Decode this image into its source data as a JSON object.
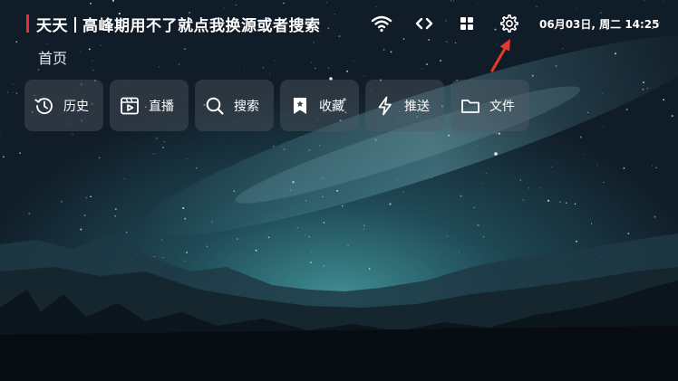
{
  "header": {
    "app_name": "天天",
    "notice": "高峰期用不了就点我换源或者搜索",
    "datetime": "06月03日, 周二 14:25",
    "icons": [
      "wifi-icon",
      "code-icon",
      "grid-icon",
      "gear-icon"
    ]
  },
  "page": {
    "label": "首页"
  },
  "menu": {
    "items": [
      {
        "label": "历史",
        "icon": "history-icon"
      },
      {
        "label": "直播",
        "icon": "live-icon"
      },
      {
        "label": "搜索",
        "icon": "search-icon"
      },
      {
        "label": "收藏",
        "icon": "bookmark-icon"
      },
      {
        "label": "推送",
        "icon": "bolt-icon"
      },
      {
        "label": "文件",
        "icon": "folder-icon"
      }
    ]
  },
  "colors": {
    "accent": "#e5312f",
    "arrow": "#e63a2a",
    "tile_bg": "#505a64"
  }
}
